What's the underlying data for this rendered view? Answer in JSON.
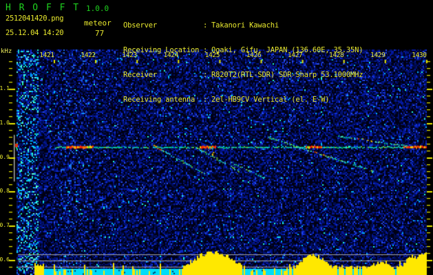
{
  "app": {
    "title": "H R O F F T",
    "version": "1.0.0",
    "filename": "2512041420.png",
    "mode": "meteor",
    "datetime": "25.12.04 14:20",
    "echo_count": "77"
  },
  "info": {
    "colon": ":",
    "rows": [
      {
        "label": "Observer",
        "value": "Takanori Kawachi"
      },
      {
        "label": "Receiving Location",
        "value": "Ogaki, Gifu, JAPAN (136.60E, 35.35N)"
      },
      {
        "label": "Receiver",
        "value": "R820T2(RTL-SDR) SDR-Sharp 53.1000MHz"
      },
      {
        "label": "Receiving antenna",
        "value": "2el-HB9CV Vertical (el. E-W)"
      }
    ]
  },
  "colors": {
    "title_green": "#1fd41f",
    "text_yellow": "#e9e92e",
    "tick_yellow": "#e8e800",
    "hotspot_red": "#ff2800",
    "carrier_green": "#00e070",
    "level_yellow": "#ffe800",
    "strip_cyan": "#00dcf8",
    "gray_line": "#a8a8a8"
  },
  "chart_data": {
    "type": "heatmap",
    "description": "HROFFT radio meteor echo spectrogram, 10-minute window, with signal-level strip at bottom",
    "x_axis": {
      "unit": "time HHMM",
      "tick_labels": [
        "1421",
        "1422",
        "1423",
        "1424",
        "1425",
        "1426",
        "1427",
        "1428",
        "1429",
        "1430"
      ],
      "range_minutes": [
        1420.3,
        1430.2
      ]
    },
    "y_axis": {
      "label": "kHz",
      "tick_labels": [
        "1.1",
        "1.0",
        "0.9",
        "0.8",
        "0.7",
        "0.6"
      ],
      "range_khz": [
        0.56,
        1.21
      ],
      "minor_step_khz": 0.02
    },
    "carrier_line": {
      "freq_khz": 0.93,
      "t_start": 1421.2,
      "t_end": 1430.2,
      "hotspots_t": [
        [
          1421.46,
          1422.13
        ],
        [
          1424.68,
          1425.08
        ],
        [
          1427.26,
          1427.65
        ],
        [
          1429.62,
          1430.17
        ]
      ]
    },
    "meteor_trails": [
      {
        "t0": 1423.58,
        "f0": 0.935,
        "t1": 1424.79,
        "f1": 0.853,
        "strength": "strong",
        "red": [
          0.0,
          0.18
        ]
      },
      {
        "t0": 1424.6,
        "f0": 0.929,
        "t1": 1425.63,
        "f1": 0.861,
        "strength": "strong"
      },
      {
        "t0": 1425.0,
        "f0": 0.931,
        "t1": 1425.0,
        "f1": 0.903,
        "strength": "strong",
        "red": [
          0.0,
          1.0
        ]
      },
      {
        "t0": 1425.46,
        "f0": 0.885,
        "t1": 1426.24,
        "f1": 0.841,
        "strength": "faint"
      },
      {
        "t0": 1426.34,
        "f0": 0.959,
        "t1": 1428.92,
        "f1": 0.859,
        "strength": "strong",
        "red": [
          0.42,
          0.55
        ]
      },
      {
        "t0": 1428.04,
        "f0": 0.963,
        "t1": 1429.73,
        "f1": 0.933,
        "strength": "strong",
        "red": [
          0.28,
          0.5
        ]
      }
    ],
    "detection_band_marker": {
      "f_top_khz": 0.965,
      "f_bottom_khz": 0.829
    },
    "threshold_lines_khz": [
      0.616,
      0.598,
      0.58
    ],
    "bottom_signal_level": {
      "points_t_h": [
        [
          1420.83,
          14
        ],
        [
          1420.88,
          10
        ],
        [
          1420.97,
          5
        ],
        [
          1421.22,
          4
        ],
        [
          1421.55,
          5
        ],
        [
          1422.05,
          6
        ],
        [
          1422.55,
          5
        ],
        [
          1423.21,
          6
        ],
        [
          1423.71,
          5
        ],
        [
          1424.13,
          6
        ],
        [
          1424.24,
          8
        ],
        [
          1424.38,
          16
        ],
        [
          1424.54,
          22
        ],
        [
          1424.71,
          28
        ],
        [
          1424.88,
          32
        ],
        [
          1425.04,
          34
        ],
        [
          1425.21,
          33
        ],
        [
          1425.37,
          28
        ],
        [
          1425.54,
          22
        ],
        [
          1425.71,
          14
        ],
        [
          1425.84,
          9
        ],
        [
          1425.96,
          6
        ],
        [
          1426.21,
          6
        ],
        [
          1426.54,
          7
        ],
        [
          1426.87,
          8
        ],
        [
          1427.04,
          12
        ],
        [
          1427.21,
          24
        ],
        [
          1427.37,
          28
        ],
        [
          1427.45,
          30
        ],
        [
          1427.62,
          24
        ],
        [
          1427.79,
          20
        ],
        [
          1427.87,
          14
        ],
        [
          1428.04,
          10
        ],
        [
          1428.2,
          12
        ],
        [
          1428.37,
          10
        ],
        [
          1428.53,
          12
        ],
        [
          1428.7,
          10
        ],
        [
          1428.87,
          14
        ],
        [
          1429.0,
          18
        ],
        [
          1429.12,
          16
        ],
        [
          1429.2,
          18
        ],
        [
          1429.33,
          12
        ],
        [
          1429.45,
          10
        ],
        [
          1429.62,
          16
        ],
        [
          1429.7,
          22
        ],
        [
          1429.78,
          26
        ],
        [
          1429.87,
          28
        ],
        [
          1429.95,
          26
        ],
        [
          1430.03,
          28
        ],
        [
          1430.11,
          30
        ],
        [
          1430.16,
          38
        ],
        [
          1430.2,
          20
        ]
      ]
    }
  }
}
